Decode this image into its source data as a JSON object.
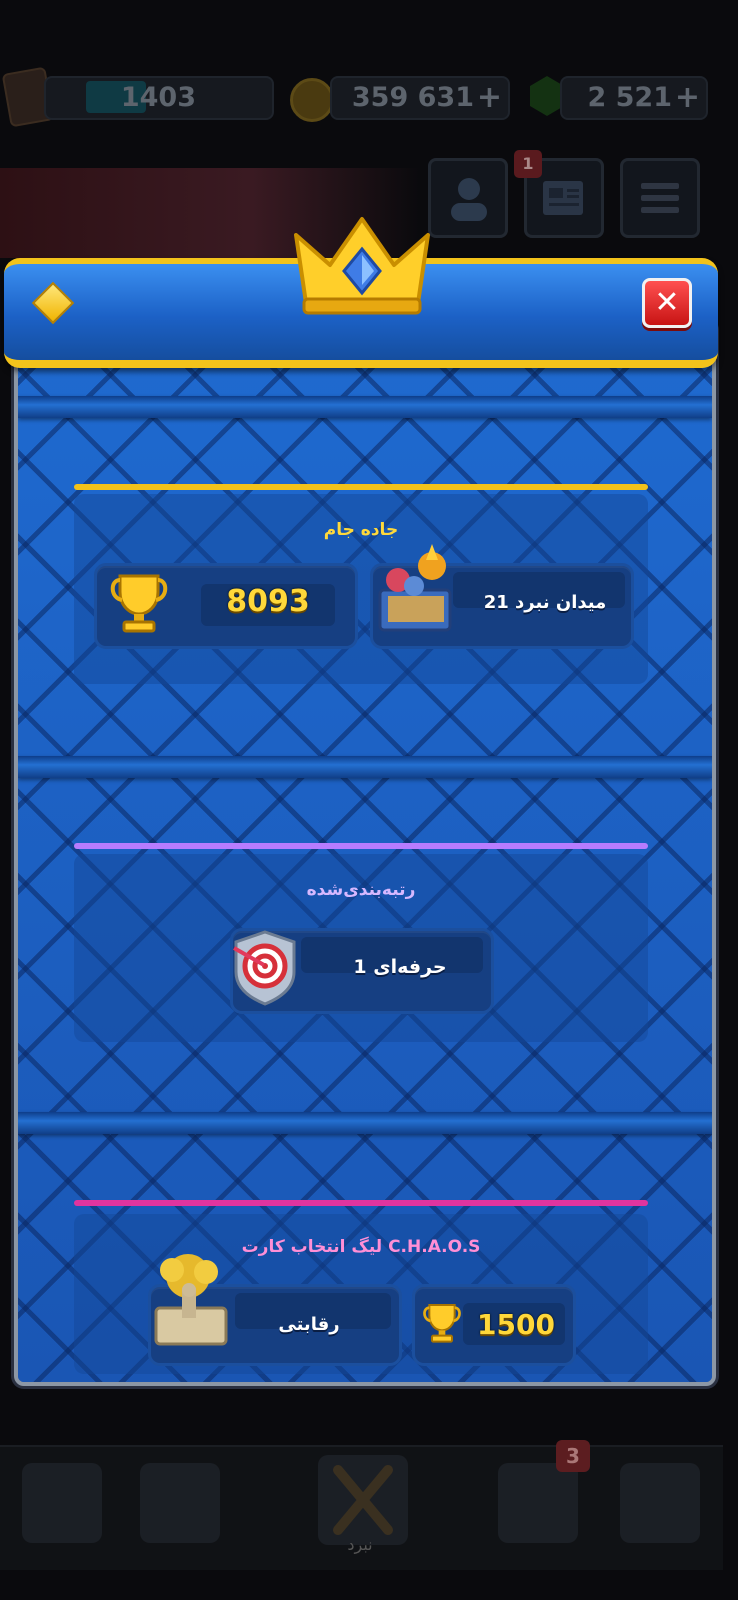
{
  "resources": {
    "level_xp": "1403",
    "gold": "359 631",
    "gems": "2 521",
    "plus": "+"
  },
  "notifications": {
    "news_count": "1",
    "battle_badge": "3"
  },
  "nav": {
    "battle_label": "نبرد"
  },
  "modal": {
    "close_label": "✕",
    "trophy_road": {
      "title": "جاده جام",
      "trophies": "8093",
      "arena": "میدان نبرد 21"
    },
    "ranked": {
      "title": "رتبه‌بندی‌شده",
      "league": "حرفه‌ای 1"
    },
    "chaos": {
      "title": "لیگ انتخاب کارت C.H.A.O.S",
      "mode": "رقابتی",
      "trophies": "1500"
    }
  },
  "colors": {
    "gold": "#f3c31b",
    "trophy_road_line": "#f2c21a",
    "ranked_line": "#b77cff",
    "chaos_line": "#e0349f",
    "panel_blue": "#1b5cb8"
  }
}
